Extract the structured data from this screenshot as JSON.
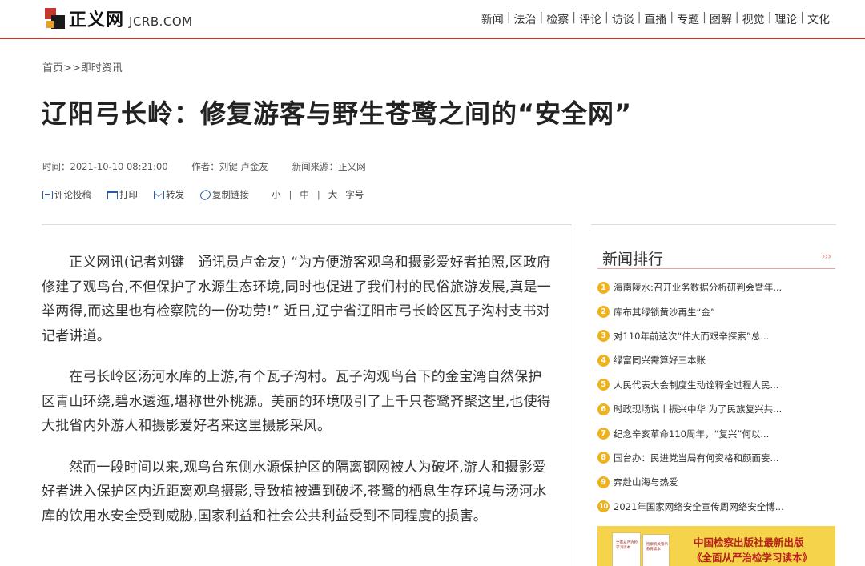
{
  "header": {
    "logo_text": "正义网",
    "logo_domain": "JCRB.COM",
    "nav": [
      "新闻",
      "法治",
      "检察",
      "评论",
      "访谈",
      "直播",
      "专题",
      "图解",
      "视觉",
      "理论",
      "文化"
    ],
    "nav_separator": "|"
  },
  "breadcrumb": "首页>>即时资讯",
  "article": {
    "title": "辽阳弓长岭：修复游客与野生苍鹭之间的“安全网”",
    "time": "时间：2021-10-10 08:21:00",
    "author": "作者：刘键 卢金友",
    "source": "新闻来源：正义网",
    "tools": {
      "comment": "评论投稿",
      "print": "打印",
      "forward": "转发",
      "copy_link": "复制链接"
    },
    "font_size": {
      "small": "小",
      "medium": "中",
      "large": "大",
      "separator": "|",
      "label": "字号"
    },
    "paragraphs": [
      "正义网讯(记者刘键　通讯员卢金友) “为方便游客观鸟和摄影爱好者拍照,区政府修建了观鸟台,不但保护了水源生态环境,同时也促进了我们村的民俗旅游发展,真是一举两得,而这里也有检察院的一份功劳!” 近日,辽宁省辽阳市弓长岭区瓦子沟村支书对记者讲道。",
      "在弓长岭区汤河水库的上游,有个瓦子沟村。瓦子沟观鸟台下的金宝湾自然保护区青山环绕,碧水逶迤,堪称世外桃源。美丽的环境吸引了上千只苍鹭齐聚这里,也使得大批省内外游人和摄影爱好者来这里摄影采风。",
      "然而一段时间以来,观鸟台东侧水源保护区的隔离钢网被人为破坏,游人和摄影爱好者进入保护区内近距离观鸟摄影,导致植被遭到破坏,苍鹭的栖息生存环境与汤河水库的饮用水安全受到威胁,国家利益和社会公共利益受到不同程度的损害。"
    ]
  },
  "sidebar": {
    "title": "新闻排行",
    "more": "›››",
    "items": [
      {
        "rank": "1",
        "text": "海南陵水:召开业务数据分析研判会暨年..."
      },
      {
        "rank": "2",
        "text": "库布其绿锁黄沙再生“金”"
      },
      {
        "rank": "3",
        "text": "对110年前这次“伟大而艰辛探索”总..."
      },
      {
        "rank": "4",
        "text": "绿富同兴需算好三本账"
      },
      {
        "rank": "5",
        "text": "人民代表大会制度生动诠释全过程人民..."
      },
      {
        "rank": "6",
        "text": "时政现场说丨振兴中华 为了民族复兴共..."
      },
      {
        "rank": "7",
        "text": "纪念辛亥革命110周年，“复兴”何以..."
      },
      {
        "rank": "8",
        "text": "国台办：民进党当局有何资格和颜面妄..."
      },
      {
        "rank": "9",
        "text": "奔赴山海与热爱"
      },
      {
        "rank": "10",
        "text": "2021年国家网络安全宣传周网络安全博..."
      }
    ],
    "ad": {
      "line1": "中国检察出版社最新出版",
      "line2": "《全面从严治检学习读本》",
      "book1": "全面从严治检学习读本",
      "book2": "检察机关警示教育读本"
    }
  },
  "colors": {
    "header_rule": "#c23a2b",
    "rank_badge": "#f0b21c",
    "ad_bg": "#f5d34a",
    "ad_text": "#b5221a",
    "tool_icon": "#2a5aa8"
  }
}
